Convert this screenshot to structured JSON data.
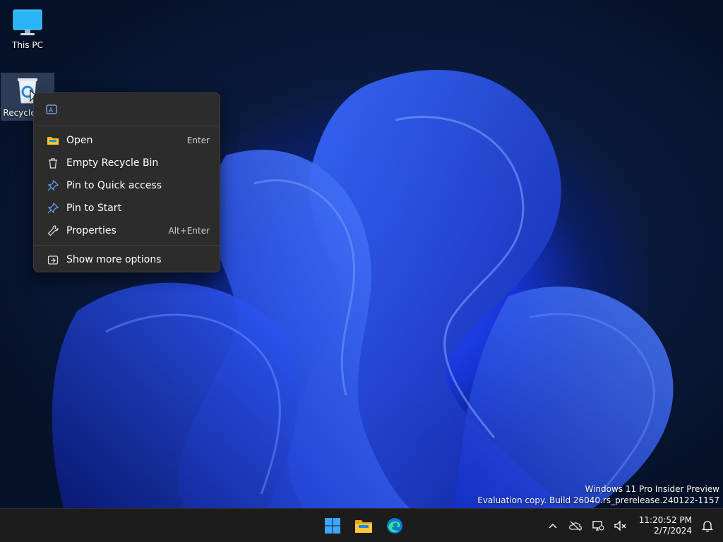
{
  "desktop": {
    "icons": [
      {
        "label": "This PC",
        "icon": "monitor-icon"
      },
      {
        "label": "Recycle Bin",
        "icon": "recycle-bin-icon"
      }
    ]
  },
  "context_menu": {
    "top_icon": "ai-rewrite-icon",
    "items": [
      {
        "label": "Open",
        "shortcut": "Enter",
        "icon": "folder-icon"
      },
      {
        "label": "Empty Recycle Bin",
        "shortcut": "",
        "icon": "trash-icon"
      },
      {
        "label": "Pin to Quick access",
        "shortcut": "",
        "icon": "pin-icon"
      },
      {
        "label": "Pin to Start",
        "shortcut": "",
        "icon": "pin-icon"
      },
      {
        "label": "Properties",
        "shortcut": "Alt+Enter",
        "icon": "wrench-icon"
      }
    ],
    "more": {
      "label": "Show more options",
      "icon": "more-options-icon"
    }
  },
  "watermark": {
    "line1": "Windows 11 Pro Insider Preview",
    "line2": "Evaluation copy. Build 26040.rs_prerelease.240122-1157"
  },
  "taskbar": {
    "apps": [
      {
        "name": "start",
        "icon": "windows-logo-icon"
      },
      {
        "name": "file-explorer",
        "icon": "folder-icon"
      },
      {
        "name": "edge",
        "icon": "edge-icon"
      }
    ],
    "clock": {
      "time": "11:20:52 PM",
      "date": "2/7/2024"
    }
  },
  "colors": {
    "accent": "#2c54ff",
    "menu_bg": "#2c2c2c",
    "taskbar_bg": "#1c1c1c"
  }
}
